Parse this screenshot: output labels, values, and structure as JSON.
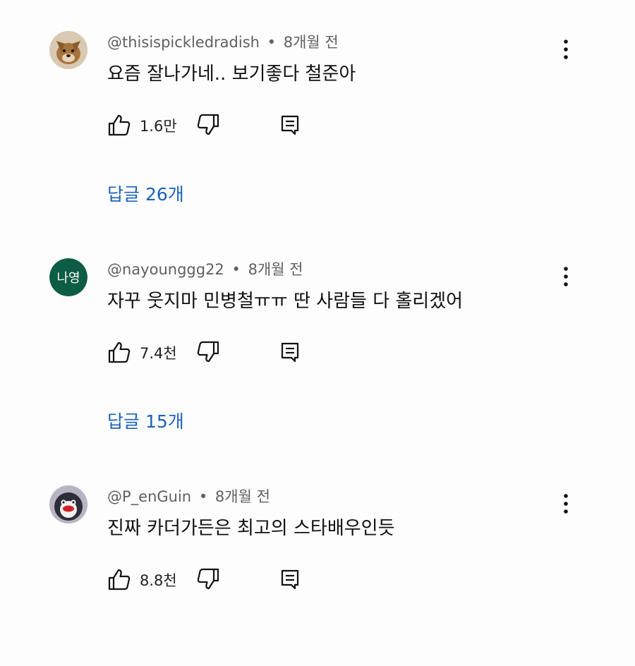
{
  "comments": [
    {
      "handle": "@thisispickledradish",
      "separator": "•",
      "time": "8개월 전",
      "text": "요즘 잘나가네.. 보기좋다 철준아",
      "likes": "1.6만",
      "replies": "답글 26개",
      "avatar_icon": "brown-dog-avatar"
    },
    {
      "handle": "@nayounggg22",
      "separator": "•",
      "time": "8개월 전",
      "text": "자꾸 웃지마 민병철ㅠㅠ 딴 사람들 다 홀리겠어",
      "likes": "7.4천",
      "replies": "답글 15개",
      "avatar_initial": "나영",
      "avatar_color": "#0d5c45"
    },
    {
      "handle": "@P_enGuin",
      "separator": "•",
      "time": "8개월 전",
      "text": "진짜 카더가든은 최고의 스타배우인듯",
      "likes": "8.8천",
      "avatar_icon": "penguin-avatar"
    }
  ],
  "colors": {
    "link": "#1c62b9",
    "meta": "#606060",
    "text": "#0f0f0f"
  }
}
